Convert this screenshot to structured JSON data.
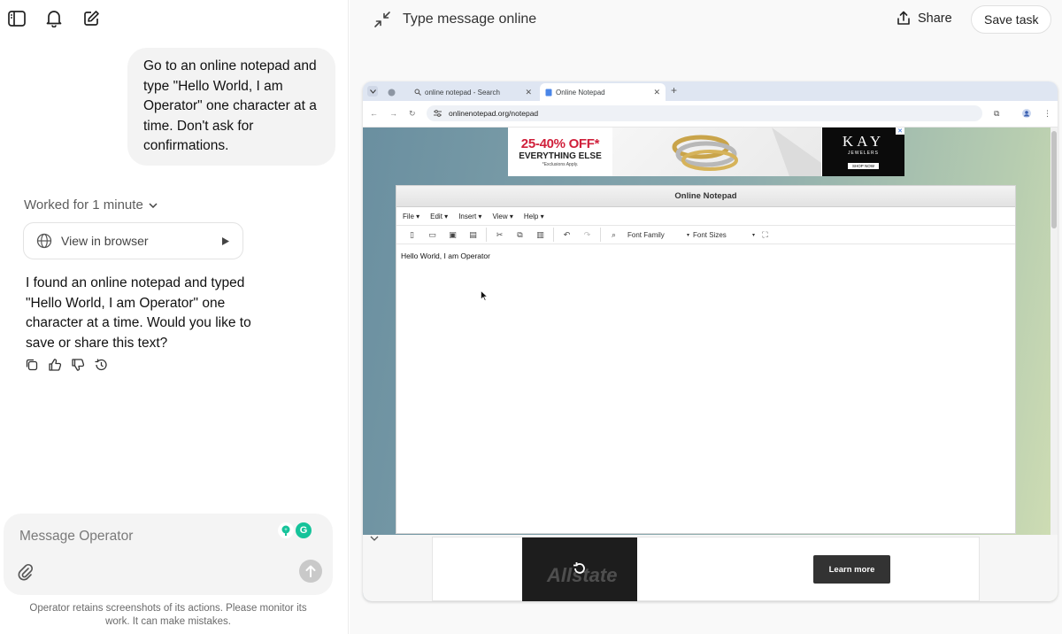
{
  "sidebar": {
    "icons": [
      "sidebar-toggle-icon",
      "bell-icon",
      "new-chat-icon"
    ]
  },
  "conversation": {
    "user_message": "Go to an online notepad and type \"Hello World, I am Operator\" one character at a time. Don't ask for confirmations.",
    "worked_label": "Worked for 1 minute",
    "view_in_browser_label": "View in browser",
    "assistant_reply": "I found an online notepad and typed \"Hello World, I am Operator\" one character at a time. Would you like to save or share this text?",
    "action_icons": [
      "copy-icon",
      "thumbs-up-icon",
      "thumbs-down-icon",
      "history-icon"
    ]
  },
  "composer": {
    "placeholder": "Message Operator",
    "disclaimer": "Operator retains screenshots of its actions. Please monitor its work. It can make mistakes."
  },
  "task_header": {
    "title": "Type message online",
    "share_label": "Share",
    "save_task_label": "Save task"
  },
  "browser": {
    "tabs": [
      {
        "label": "online notepad - Search"
      },
      {
        "label": "Online Notepad"
      }
    ],
    "url": "onlinenotepad.org/notepad",
    "ad_top": {
      "promo_big": "25-40% OFF*",
      "promo_mid": "EVERYTHING ELSE",
      "promo_small": "*Exclusions Apply.",
      "brand": "KAY",
      "brand_sub": "JEWELERS",
      "cta": "SHOP NOW"
    },
    "notepad": {
      "title": "Online Notepad",
      "menu": [
        "File",
        "Edit",
        "Insert",
        "View",
        "Help"
      ],
      "font_family_label": "Font Family",
      "font_sizes_label": "Font Sizes",
      "content": "Hello World, I am Operator"
    },
    "ad_bottom": {
      "brand": "Allstate",
      "cta": "Learn more"
    }
  },
  "colors": {
    "accent_green": "#15c39a",
    "ad_red": "#d0203b",
    "page_bg_start": "#6a8fa0",
    "page_bg_end": "#d2dfb4"
  }
}
